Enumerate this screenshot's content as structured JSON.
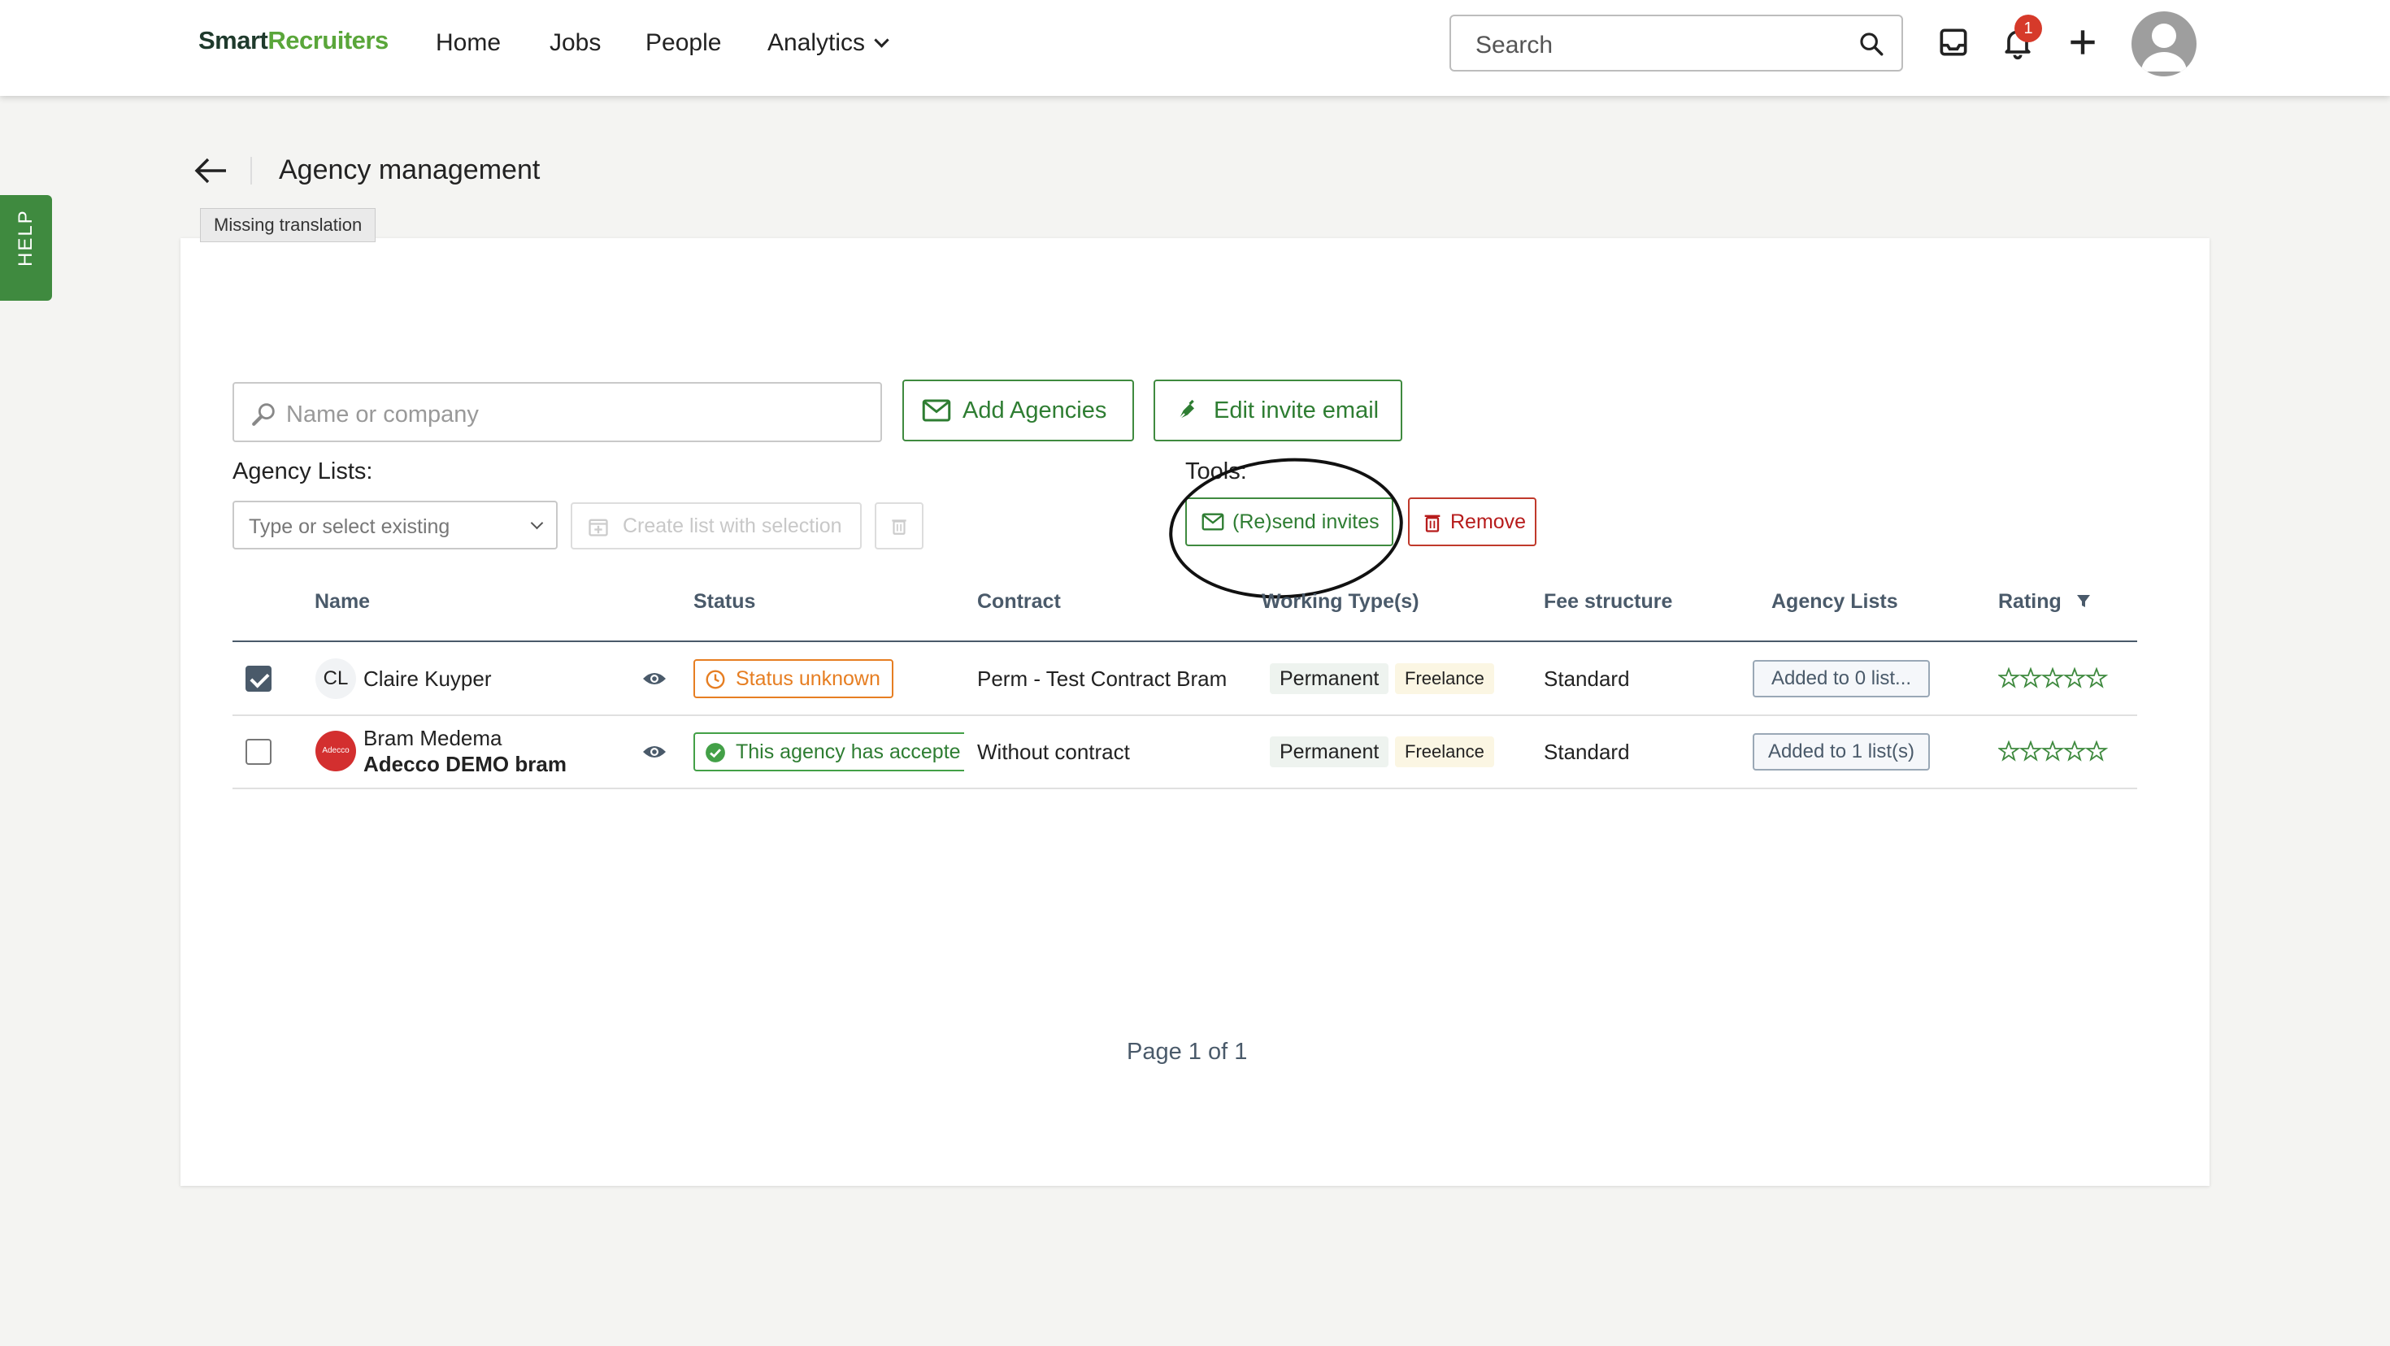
{
  "brand": {
    "logo_part1": "Smart",
    "logo_part2": "Recruiters",
    "green": "#3f8a3f"
  },
  "nav": {
    "items": [
      {
        "label": "Home"
      },
      {
        "label": "Jobs"
      },
      {
        "label": "People"
      },
      {
        "label": "Analytics"
      }
    ],
    "search_placeholder": "Search",
    "notification_count": "1"
  },
  "help_tab": "HELP",
  "header": {
    "title": "Agency management",
    "tooltip": "Missing translation"
  },
  "toolbar": {
    "name_placeholder": "Name or company",
    "add_agencies": "Add Agencies",
    "edit_invite_email": "Edit invite email",
    "agency_lists_label": "Agency Lists:",
    "list_select_placeholder": "Type or select existing",
    "create_list": "Create list with selection",
    "tools_label": "Tools:",
    "resend_invites": "(Re)send invites",
    "remove": "Remove"
  },
  "table": {
    "columns": [
      "Name",
      "Status",
      "Contract",
      "Working Type(s)",
      "Fee structure",
      "Agency Lists",
      "Rating"
    ],
    "rows": [
      {
        "checked": true,
        "initials": "CL",
        "name": "Claire Kuyper",
        "company": "",
        "status": "Status unknown",
        "contract": "Perm - Test Contract Bram",
        "working_types": [
          "Permanent",
          "Freelance"
        ],
        "fee": "Standard",
        "lists": "Added to 0 list...",
        "rating": 0
      },
      {
        "checked": false,
        "logo_text": "Adecco",
        "name": "Bram Medema",
        "company": "Adecco DEMO bram",
        "status": "This agency has accepte",
        "contract": "Without contract",
        "working_types": [
          "Permanent",
          "Freelance"
        ],
        "fee": "Standard",
        "lists": "Added to 1 list(s)",
        "rating": 0
      }
    ]
  },
  "pagination": "Page 1 of 1"
}
